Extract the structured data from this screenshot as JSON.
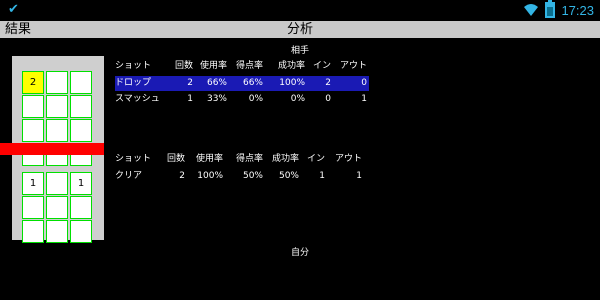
{
  "status_bar": {
    "time": "17:23",
    "check_icon": "check-icon",
    "wifi_icon": "wifi-icon",
    "battery_icon": "battery-icon",
    "accent": "#33b5e5"
  },
  "title_bar": {
    "left": "結果",
    "center": "分析"
  },
  "court": {
    "top_cells": [
      [
        "2",
        "",
        ""
      ],
      [
        "",
        "",
        ""
      ],
      [
        "",
        "",
        ""
      ],
      [
        "",
        "",
        ""
      ]
    ],
    "bottom_cells": [
      [
        "1",
        "",
        "1"
      ],
      [
        "",
        "",
        ""
      ],
      [
        "",
        "",
        ""
      ]
    ]
  },
  "opponent": {
    "title": "相手",
    "headers": [
      "ショット",
      "回数",
      "使用率",
      "得点率",
      "成功率",
      "イン",
      "アウト"
    ],
    "rows": [
      [
        "ドロップ",
        "2",
        "66%",
        "66%",
        "100%",
        "2",
        "0"
      ],
      [
        "スマッシュ",
        "1",
        "33%",
        "0%",
        "0%",
        "0",
        "1"
      ]
    ]
  },
  "self": {
    "title": "自分",
    "headers": [
      "ショット",
      "回数",
      "使用率",
      "得点率",
      "成功率",
      "イン",
      "アウト"
    ],
    "rows": [
      [
        "クリア",
        "2",
        "100%",
        "50%",
        "50%",
        "1",
        "1"
      ]
    ]
  },
  "colors": {
    "selected_row": "#1a1ab4",
    "net": "#ff0000",
    "grid": "#00e000",
    "highlight": "#ffff00"
  }
}
